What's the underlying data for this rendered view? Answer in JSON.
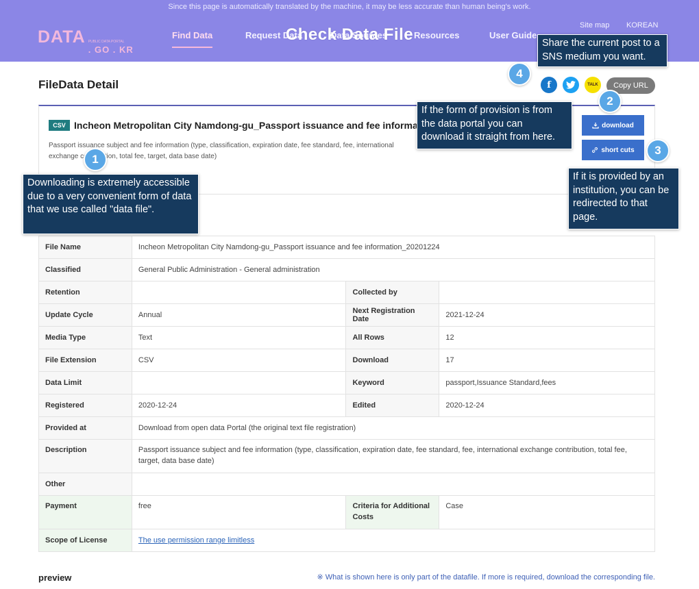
{
  "header": {
    "notice": "Since this page is automatically translated by the machine, it may be less accurate than human being's work.",
    "logo_main": "DATA",
    "logo_small": "PUBLIC DATA PORTAL",
    "logo_domain": ". GO . KR",
    "nav": [
      "Find Data",
      "Request Data",
      "Data Sources",
      "Resources",
      "User Guide"
    ],
    "site_map": "Site map",
    "language": "KOREAN",
    "banner_title": "Check Data File"
  },
  "page_title": "FileData Detail",
  "share": {
    "facebook": "f",
    "twitter": "t",
    "kakao": "TALK",
    "copy_url": "Copy URL"
  },
  "dataset": {
    "format_badge": "CSV",
    "title": "Incheon Metropolitan City Namdong-gu_Passport issuance and fee information",
    "description": "Passport issuance subject and fee information (type, classification, expiration date, fee standard, fee, international exchange contribution, total fee, target, data base date)",
    "download_label": "download",
    "shortcut_label": "short cuts"
  },
  "table": {
    "file_name_label": "File Name",
    "file_name": "Incheon Metropolitan City Namdong-gu_Passport issuance and fee information_20201224",
    "classified_label": "Classified",
    "classified": "General Public Administration - General administration",
    "retention_label": "Retention",
    "retention": "",
    "collected_by_label": "Collected by",
    "collected_by": "",
    "update_cycle_label": "Update Cycle",
    "update_cycle": "Annual",
    "next_reg_label": "Next Registration Date",
    "next_reg": "2021-12-24",
    "media_type_label": "Media Type",
    "media_type": "Text",
    "all_rows_label": "All Rows",
    "all_rows": "12",
    "file_ext_label": "File Extension",
    "file_ext": "CSV",
    "download_count_label": "Download",
    "download_count": "17",
    "data_limit_label": "Data Limit",
    "data_limit": "",
    "keyword_label": "Keyword",
    "keyword": "passport,Issuance Standard,fees",
    "registered_label": "Registered",
    "registered": "2020-12-24",
    "edited_label": "Edited",
    "edited": "2020-12-24",
    "provided_at_label": "Provided at",
    "provided_at": "Download from open data Portal (the original text file registration)",
    "description_label": "Description",
    "description": "Passport issuance subject and fee information (type, classification, expiration date, fee standard, fee, international exchange contribution, total fee, target, data base date)",
    "other_label": "Other",
    "other": "",
    "payment_label": "Payment",
    "payment": "free",
    "criteria_label": "Criteria for Additional Costs",
    "criteria": "Case",
    "license_label": "Scope of License",
    "license": "The use permission range limitless"
  },
  "preview": {
    "title": "preview",
    "note": "※ What is shown here is only part of the datafile. If more is required, download the corresponding file."
  },
  "callouts": {
    "step1_num": "1",
    "step1_text": "Downloading is extremely accessible due to a very convenient form of data that we use called \"data file\".",
    "step2_num": "2",
    "step2_text": "If the form of provision is from the data portal you can download it straight from here.",
    "step3_num": "3",
    "step3_text": "If it is provided by an institution, you can be redirected to that page.",
    "step4_num": "4",
    "step4_text": "Share the current post to a SNS medium you want."
  },
  "colors": {
    "header_bg": "#8b86e6",
    "accent_pink": "#f7b9db",
    "button_blue": "#3a6fcb",
    "callout_bg": "#163a5e",
    "step_circle": "#5aa7e6"
  }
}
